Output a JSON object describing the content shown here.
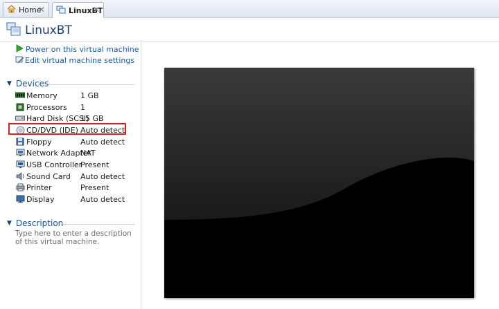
{
  "tabs": [
    {
      "label": "Home",
      "icon": "home-icon"
    },
    {
      "label": "LinuxBT",
      "icon": "vm-icon"
    }
  ],
  "page": {
    "title": "LinuxBT"
  },
  "actions": [
    {
      "label": "Power on this virtual machine",
      "icon": "play-icon"
    },
    {
      "label": "Edit virtual machine settings",
      "icon": "settings-icon"
    }
  ],
  "devices": {
    "heading": "Devices",
    "items": [
      {
        "name": "Memory",
        "value": "1 GB",
        "icon": "memory-icon"
      },
      {
        "name": "Processors",
        "value": "1",
        "icon": "processor-icon"
      },
      {
        "name": "Hard Disk (SCSI)",
        "value": "15 GB",
        "icon": "hard-disk-icon"
      },
      {
        "name": "CD/DVD (IDE)",
        "value": "Auto detect",
        "icon": "cd-dvd-icon"
      },
      {
        "name": "Floppy",
        "value": "Auto detect",
        "icon": "floppy-icon"
      },
      {
        "name": "Network Adapter",
        "value": "NAT",
        "icon": "network-adapter-icon"
      },
      {
        "name": "USB Controller",
        "value": "Present",
        "icon": "usb-icon"
      },
      {
        "name": "Sound Card",
        "value": "Auto detect",
        "icon": "sound-card-icon"
      },
      {
        "name": "Printer",
        "value": "Present",
        "icon": "printer-icon"
      },
      {
        "name": "Display",
        "value": "Auto detect",
        "icon": "display-icon"
      }
    ]
  },
  "description": {
    "heading": "Description",
    "placeholder": "Type here to enter a description of this virtual machine."
  },
  "colors": {
    "highlight": "#e0201c",
    "link": "#1a5aa8",
    "heading": "#1c4f96"
  }
}
